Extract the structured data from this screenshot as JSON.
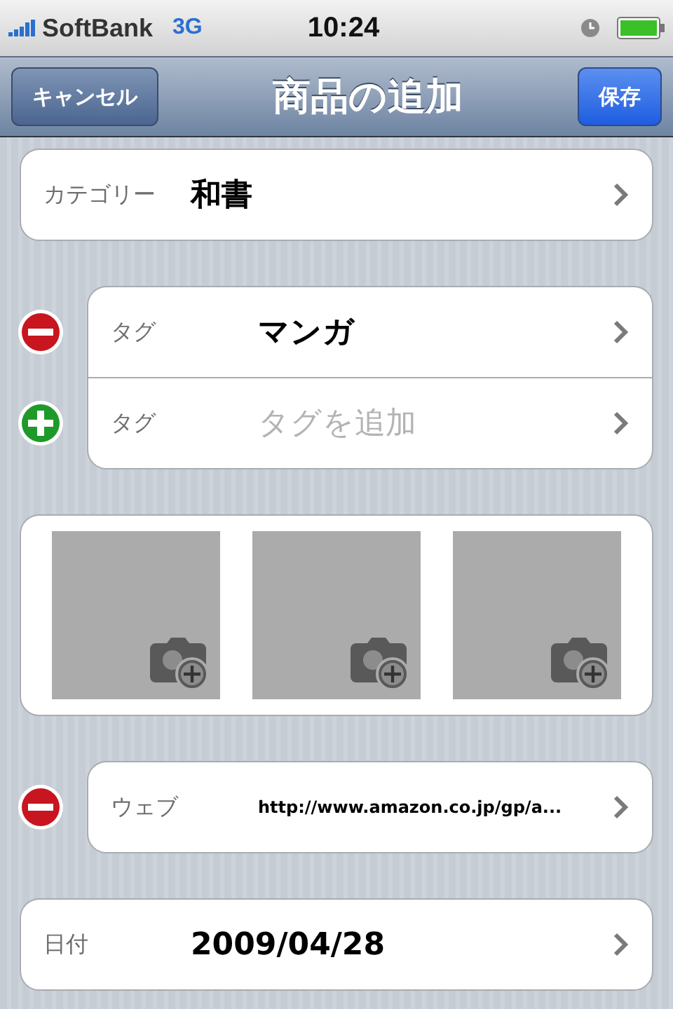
{
  "status_bar": {
    "carrier": "SoftBank",
    "network": "3G",
    "time": "10:24"
  },
  "nav_bar": {
    "left_button": "キャンセル",
    "title": "商品の追加",
    "right_button": "保存"
  },
  "groups": [
    {
      "kind": "rows",
      "rows": [
        {
          "label": "カテゴリー",
          "value": "和書"
        }
      ]
    },
    {
      "kind": "rows",
      "rows": [
        {
          "label": "タグ",
          "value": "マンガ",
          "delete_control": true
        },
        {
          "label": "タグ",
          "placeholder": "タグを追加",
          "insert_control": true
        }
      ]
    },
    {
      "kind": "photos",
      "slots": [
        {
          "kind": "empty"
        },
        {
          "kind": "empty"
        },
        {
          "kind": "empty"
        }
      ]
    },
    {
      "kind": "rows",
      "rows": [
        {
          "label": "ウェブ",
          "value": "http://www.amazon.co.jp/gp/a...",
          "kind": "url",
          "delete_control": true
        }
      ]
    },
    {
      "kind": "rows",
      "rows": [
        {
          "label": "日付",
          "value": "2009/04/28"
        }
      ]
    }
  ]
}
